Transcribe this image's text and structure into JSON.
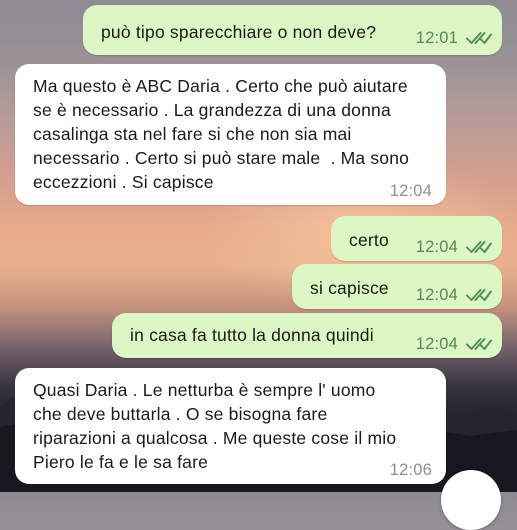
{
  "messages": [
    {
      "direction": "out",
      "text": "può tipo sparecchiare o non deve?",
      "time": "12:01",
      "status": "read-double-check"
    },
    {
      "direction": "in",
      "lines": [
        "Ma questo è ABC Daria . Certo che può aiutare",
        "se è necessario . La grandezza di una donna",
        "casalinga sta nel fare si che non sia mai",
        "necessario . Certo si può stare male  . Ma sono",
        "eccezzioni . Si capisce"
      ],
      "time": "12:04"
    },
    {
      "direction": "out",
      "text": "certo",
      "time": "12:04",
      "status": "read-double-check"
    },
    {
      "direction": "out",
      "text": "si capisce",
      "time": "12:04",
      "status": "read-double-check"
    },
    {
      "direction": "out",
      "text": "in casa fa tutto la donna quindi",
      "time": "12:04",
      "status": "read-double-check"
    },
    {
      "direction": "in",
      "lines": [
        "Quasi Daria . Le netturba è sempre l' uomo",
        "che deve buttarla . O se bisogna fare",
        "riparazioni a qualcosa . Me queste cose il mio",
        "Piero le fa e le sa fare"
      ],
      "time": "12:06"
    }
  ],
  "colors": {
    "outgoing_bubble": "#dcf6c4",
    "incoming_bubble": "#ffffff",
    "outgoing_time": "#4f8c57",
    "incoming_time": "#8a8f92",
    "read_ticks": "#4f8c57"
  },
  "icons": {
    "ticks": "double-check-icon",
    "fab": "scroll-down-button"
  }
}
